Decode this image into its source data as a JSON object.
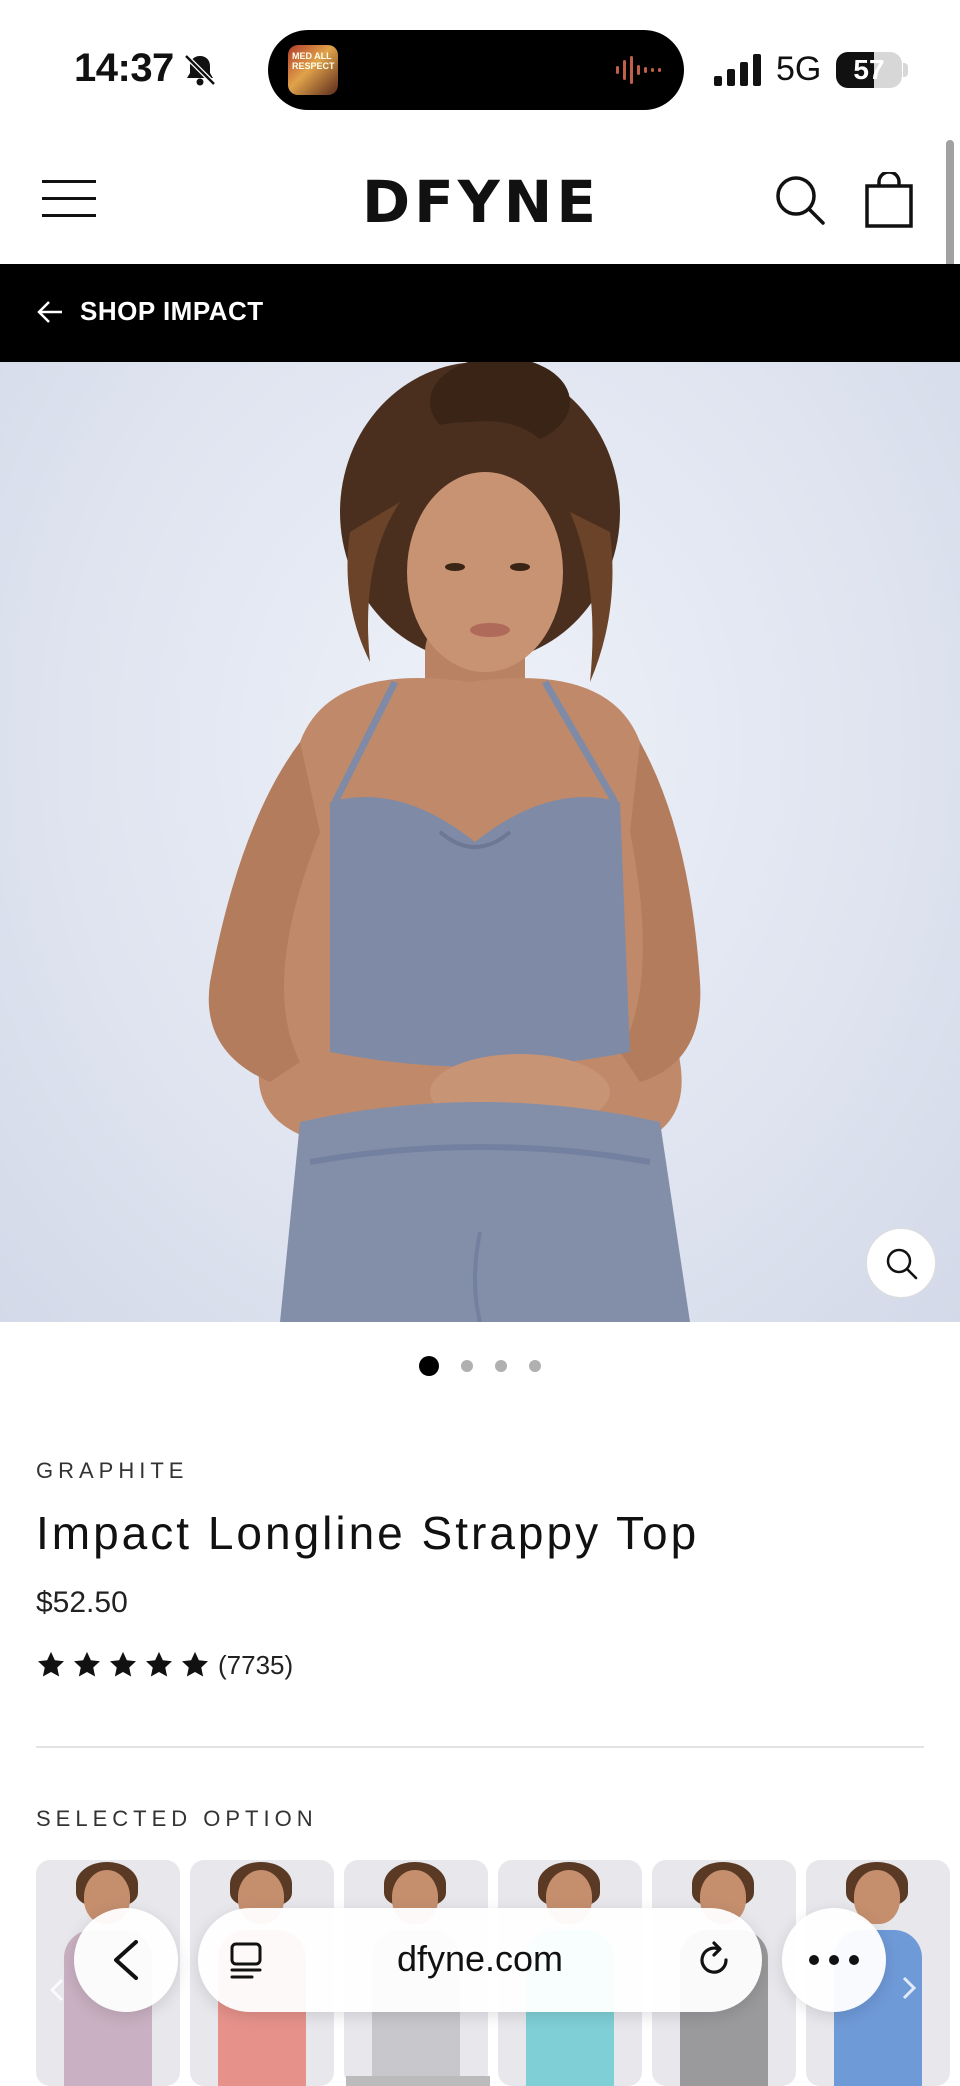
{
  "status_bar": {
    "time": "14:37",
    "network": "5G",
    "battery_level": "57",
    "battery_percent": 57,
    "icons": [
      "bell-slash-icon",
      "signal-bars-icon",
      "battery-icon"
    ]
  },
  "now_playing": {
    "art_text": "MED ALL RESPECT"
  },
  "header": {
    "logo": "DFYNE",
    "icons": [
      "hamburger-menu-icon",
      "search-icon",
      "shopping-bag-icon"
    ]
  },
  "banner": {
    "back_label": "SHOP IMPACT"
  },
  "gallery": {
    "image_count": 4,
    "active_index": 0
  },
  "product": {
    "color": "GRAPHITE",
    "title": "Impact Longline Strappy Top",
    "price": "$52.50",
    "rating_stars": 5,
    "review_count": "(7735)"
  },
  "options": {
    "label": "SELECTED OPTION",
    "swatch_colors": [
      "#c9b0c2",
      "#e6928a",
      "#c8c8cc",
      "#7fcfd6",
      "#9a9a9c",
      "#6f9ad8"
    ]
  },
  "browser": {
    "url": "dfyne.com",
    "icons": [
      "chevron-left-icon",
      "tabs-icon",
      "reload-icon",
      "more-icon"
    ]
  },
  "colors": {
    "banner_bg": "#000000",
    "product_grey": "#7f8aa6",
    "text": "#111111"
  }
}
